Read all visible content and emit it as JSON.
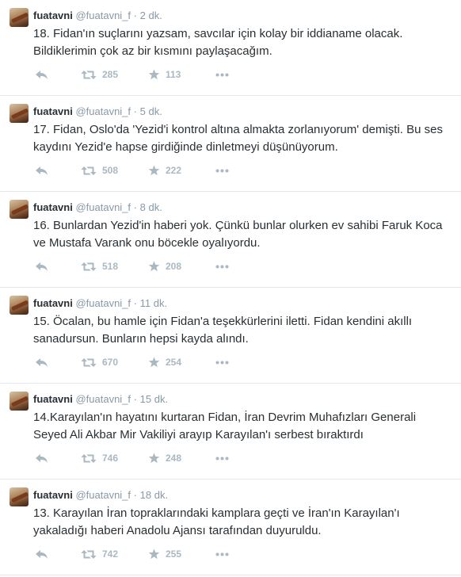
{
  "tweets": [
    {
      "name": "fuatavni",
      "handle": "@fuatavni_f",
      "sep": "·",
      "time": "2 dk.",
      "text": "18. Fidan'ın suçlarını yazsam, savcılar için kolay bir iddianame olacak. Bildiklerimin çok az bir kısmını paylaşacağım.",
      "retweets": "285",
      "favorites": "113"
    },
    {
      "name": "fuatavni",
      "handle": "@fuatavni_f",
      "sep": "·",
      "time": "5 dk.",
      "text": "17. Fidan, Oslo'da 'Yezid'i kontrol altına almakta zorlanıyorum' demişti. Bu ses kaydını Yezid'e hapse girdiğinde dinletmeyi düşünüyorum.",
      "retweets": "508",
      "favorites": "222"
    },
    {
      "name": "fuatavni",
      "handle": "@fuatavni_f",
      "sep": "·",
      "time": "8 dk.",
      "text": "16. Bunlardan Yezid'in haberi yok. Çünkü bunlar olurken ev sahibi Faruk Koca ve Mustafa Varank onu böcekle oyalıyordu.",
      "retweets": "518",
      "favorites": "208"
    },
    {
      "name": "fuatavni",
      "handle": "@fuatavni_f",
      "sep": "·",
      "time": "11 dk.",
      "text": "15. Öcalan, bu hamle için Fidan'a teşekkürlerini iletti. Fidan kendini akıllı sanadursun. Bunların hepsi kayda alındı.",
      "retweets": "670",
      "favorites": "254"
    },
    {
      "name": "fuatavni",
      "handle": "@fuatavni_f",
      "sep": "·",
      "time": "15 dk.",
      "text": "14.Karayılan'ın hayatını kurtaran Fidan, İran Devrim Muhafızları Generali Seyed Ali Akbar Mir Vakiliyi arayıp Karayılan'ı serbest bıraktırdı",
      "retweets": "746",
      "favorites": "248"
    },
    {
      "name": "fuatavni",
      "handle": "@fuatavni_f",
      "sep": "·",
      "time": "18 dk.",
      "text": "13. Karayılan İran topraklarındaki kamplara geçti ve İran'ın Karayılan'ı yakaladığı haberi Anadolu Ajansı tarafından duyuruldu.",
      "retweets": "742",
      "favorites": "255"
    }
  ],
  "colors": {
    "name": "#292f33",
    "meta": "#8899a6",
    "action": "#aab8c2",
    "divider": "#e1e8ed"
  },
  "icons": {
    "reply": "reply-icon",
    "retweet": "retweet-icon",
    "favorite": "favorite-star-icon",
    "more": "more-dots-icon"
  }
}
